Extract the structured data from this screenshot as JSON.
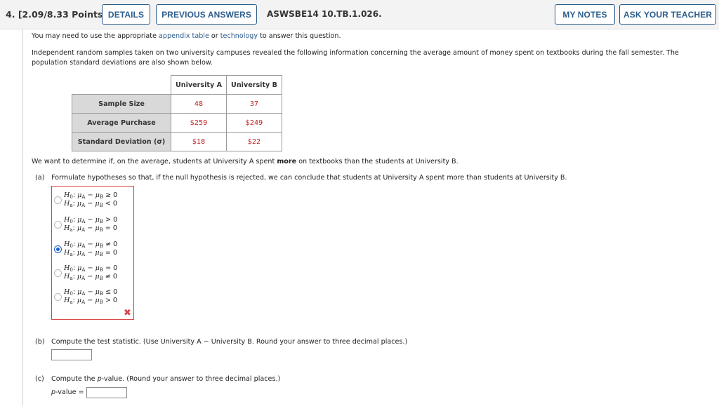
{
  "header": {
    "question_number": "4.",
    "points": "[2.09/8.33 Points]",
    "details_label": "DETAILS",
    "previous_answers_label": "PREVIOUS ANSWERS",
    "question_code": "ASWSBE14 10.TB.1.026.",
    "my_notes_label": "MY NOTES",
    "ask_teacher_label": "ASK YOUR TEACHER"
  },
  "intro": {
    "prefix": "You may need to use the appropriate ",
    "link1": "appendix table",
    "middle": " or ",
    "link2": "technology",
    "suffix": " to answer this question."
  },
  "problem": {
    "line1": "Independent random samples taken on two university campuses revealed the following information concerning the average amount of money spent on textbooks during the fall semester. The",
    "line2": "population standard deviations are also shown below."
  },
  "table": {
    "columns": [
      "University A",
      "University B"
    ],
    "rows": [
      {
        "label": "Sample Size",
        "values": [
          "48",
          "37"
        ]
      },
      {
        "label": "Average Purchase",
        "values": [
          "$259",
          "$249"
        ]
      },
      {
        "label": "Standard Deviation (σ)",
        "values": [
          "$18",
          "$22"
        ]
      }
    ]
  },
  "goal": {
    "prefix": "We want to determine if, on the average, students at University A spent ",
    "bold": "more",
    "suffix": " on textbooks than the students at University B."
  },
  "part_a": {
    "label": "(a)",
    "text": "Formulate hypotheses so that, if the null hypothesis is rejected, we can conclude that students at University A spent more than students at University B.",
    "selected_index": 2,
    "status": "incorrect",
    "options": [
      {
        "h0": "≥ 0",
        "ha": "< 0"
      },
      {
        "h0": "> 0",
        "ha": "= 0"
      },
      {
        "h0": "≠ 0",
        "ha": "= 0"
      },
      {
        "h0": "= 0",
        "ha": "≠ 0"
      },
      {
        "h0": "≤ 0",
        "ha": "> 0"
      }
    ]
  },
  "part_b": {
    "label": "(b)",
    "text": "Compute the test statistic. (Use University A − University B. Round your answer to three decimal places.)",
    "value": ""
  },
  "part_c": {
    "label": "(c)",
    "text_prefix": "Compute the ",
    "text_italic": "p",
    "text_suffix": "-value. (Round your answer to three decimal places.)",
    "input_label": "p-value =",
    "value": ""
  },
  "colors": {
    "accent": "#2d5d8c",
    "error": "#d94040",
    "value_red": "#c02020",
    "radio_selected": "#1a5fd0"
  }
}
